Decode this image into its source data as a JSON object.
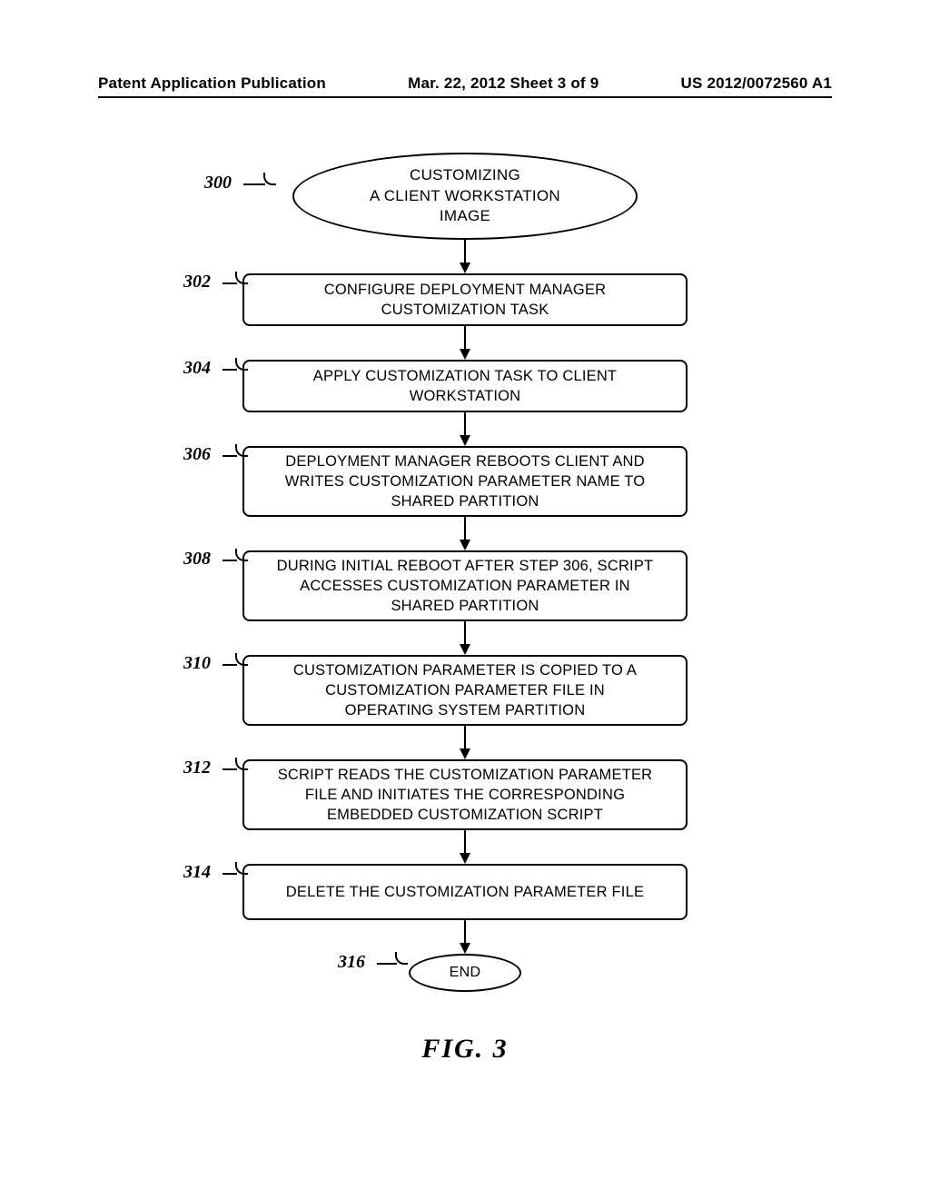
{
  "header": {
    "left": "Patent Application Publication",
    "center": "Mar. 22, 2012  Sheet 3 of 9",
    "right": "US 2012/0072560 A1"
  },
  "figure_label": "FIG.  3",
  "nodes": {
    "n300": {
      "ref": "300",
      "text": "CUSTOMIZING\nA CLIENT WORKSTATION\nIMAGE"
    },
    "n302": {
      "ref": "302",
      "text": "CONFIGURE DEPLOYMENT MANAGER\nCUSTOMIZATION TASK"
    },
    "n304": {
      "ref": "304",
      "text": "APPLY CUSTOMIZATION TASK TO CLIENT\nWORKSTATION"
    },
    "n306": {
      "ref": "306",
      "text": "DEPLOYMENT MANAGER REBOOTS CLIENT AND\nWRITES CUSTOMIZATION PARAMETER NAME TO\nSHARED PARTITION"
    },
    "n308": {
      "ref": "308",
      "text": "DURING INITIAL REBOOT AFTER STEP 306, SCRIPT\nACCESSES CUSTOMIZATION PARAMETER IN\nSHARED PARTITION"
    },
    "n310": {
      "ref": "310",
      "text": "CUSTOMIZATION PARAMETER IS COPIED TO A\nCUSTOMIZATION PARAMETER FILE IN\nOPERATING SYSTEM PARTITION"
    },
    "n312": {
      "ref": "312",
      "text": "SCRIPT READS THE CUSTOMIZATION PARAMETER\nFILE AND INITIATES THE CORRESPONDING\nEMBEDDED CUSTOMIZATION SCRIPT"
    },
    "n314": {
      "ref": "314",
      "text": "DELETE THE CUSTOMIZATION PARAMETER FILE"
    },
    "n316": {
      "ref": "316",
      "text": "END"
    }
  }
}
